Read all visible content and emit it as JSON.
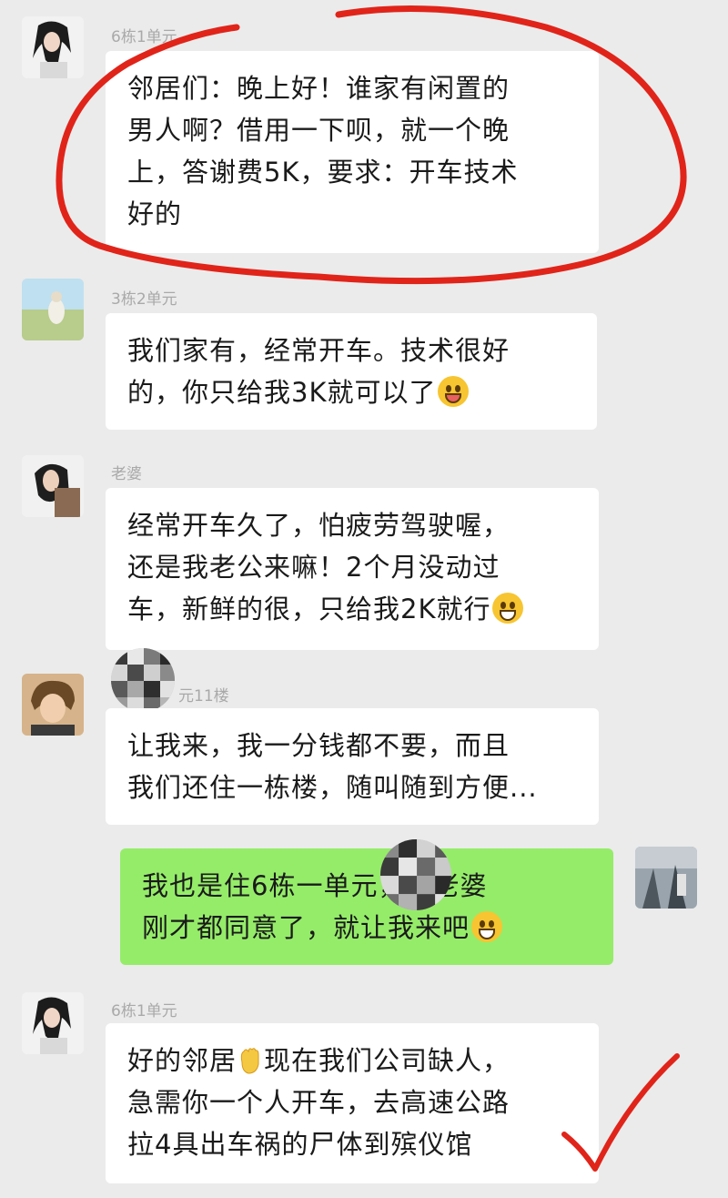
{
  "messages": [
    {
      "sender": "6栋1单元",
      "lines": [
        "邻居们：晚上好！谁家有闲置的",
        "男人啊？借用一下呗，就一个晚",
        "上，答谢费5K，要求：开车技术",
        "好的"
      ]
    },
    {
      "sender": "3栋2单元",
      "lines": [
        "我们家有，经常开车。技术很好",
        "的，你只给我3K就可以了"
      ]
    },
    {
      "sender": "老婆",
      "lines": [
        "经常开车久了，怕疲劳驾驶喔，",
        "还是我老公来嘛！2个月没动过",
        "车，新鲜的很，只给我2K就行"
      ]
    },
    {
      "sender": "元11楼",
      "lines": [
        "让我来，我一分钱都不要，而且",
        "我们还住一栋楼，随叫随到方便..."
      ]
    },
    {
      "sender": "",
      "lines": [
        "我也是住6栋一单元，我老婆",
        "刚才都同意了，就让我来吧"
      ]
    },
    {
      "sender": "6栋1单元",
      "lines": [
        "好的邻居",
        "现在我们公司缺人，",
        "急需你一个人开车，去高速公路",
        "拉4具出车祸的尸体到殡仪馆"
      ]
    }
  ],
  "colors": {
    "background": "#ebebeb",
    "bubble_in": "#ffffff",
    "bubble_out": "#95ec69",
    "annotation": "#e0241a"
  },
  "icons": [
    "tongue-out-emoji-icon",
    "grin-emoji-icon",
    "wave-hand-emoji-icon",
    "mosaic-blur-icon"
  ]
}
